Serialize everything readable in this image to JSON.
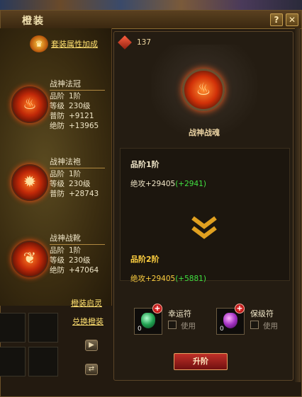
{
  "window": {
    "title": "橙装",
    "faded_header": "",
    "help_label": "?",
    "close_label": "✕"
  },
  "left": {
    "set_bonus_link": "套装属性加成",
    "set_icon_glyph": "♛",
    "items": [
      {
        "name": "战神法冠",
        "icon": "crown-icon",
        "glyph": "♨",
        "rows": [
          {
            "k": "品阶",
            "v": "1阶"
          },
          {
            "k": "等级",
            "v": "230级"
          },
          {
            "k": "普防",
            "v": "+9121"
          },
          {
            "k": "绝防",
            "v": "+13965"
          }
        ]
      },
      {
        "name": "战神法袍",
        "icon": "robe-icon",
        "glyph": "✹",
        "rows": [
          {
            "k": "品阶",
            "v": "1阶"
          },
          {
            "k": "等级",
            "v": "230级"
          },
          {
            "k": "普防",
            "v": "+28743"
          }
        ]
      },
      {
        "name": "战神战靴",
        "icon": "boots-icon",
        "glyph": "❦",
        "rows": [
          {
            "k": "品阶",
            "v": "1阶"
          },
          {
            "k": "等级",
            "v": "230级"
          },
          {
            "k": "绝防",
            "v": "+47064"
          }
        ]
      }
    ],
    "awaken_link": "橙装启灵",
    "exchange_link": "兑换橙装",
    "arrow_right": "▶",
    "arrow_swap": "⇄"
  },
  "right": {
    "count": "137",
    "orb_glyph": "♨",
    "orb_name": "战神战魂",
    "current_grade_label": "品阶1阶",
    "current_stat_label": "绝攻+29405",
    "current_stat_bonus": "(+2941)",
    "next_grade_label": "品阶2阶",
    "next_stat_label": "绝攻+29405",
    "next_stat_bonus": "(+5881)",
    "charms": [
      {
        "name": "幸运符",
        "count": "0",
        "use_label": "使用",
        "icon": "luck-charm-icon"
      },
      {
        "name": "保级符",
        "count": "0",
        "use_label": "使用",
        "icon": "protect-charm-icon"
      }
    ],
    "plus_glyph": "+",
    "upgrade_button": "升阶"
  },
  "colors": {
    "gold_link": "#ffe070",
    "green_bonus": "#40e040",
    "yellow_label": "#ffd040",
    "button_red": "#c03028"
  }
}
